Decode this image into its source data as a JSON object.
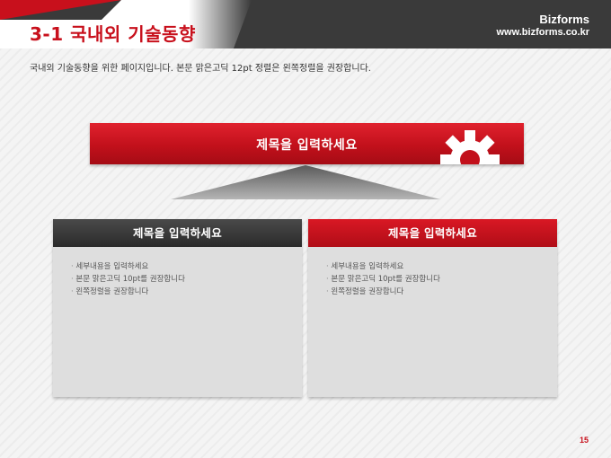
{
  "header": {
    "title": "3-1 국내외 기술동향",
    "brand_name": "Bizforms",
    "brand_url": "www.bizforms.co.kr"
  },
  "intro": "국내외 기술동향을 위한 페이지입니다. 본문 맑은고딕 12pt 정렬은 왼쪽정렬을 권장합니다.",
  "banner": {
    "title": "제목을 입력하세요",
    "icon": "gear-icon"
  },
  "cards": [
    {
      "title": "제목을 입력하세요",
      "bullets": [
        "세부내용을 입력하세요",
        "본문 맑은고딕 10pt를 권장합니다",
        "왼쪽정렬을 권장합니다"
      ]
    },
    {
      "title": "제목을 입력하세요",
      "bullets": [
        "세부내용을 입력하세요",
        "본문 맑은고딕 10pt를 권장합니다",
        "왼쪽정렬을 권장합니다"
      ]
    }
  ],
  "page_number": "15",
  "colors": {
    "accent": "#c8101c",
    "dark": "#3a3a3a"
  }
}
